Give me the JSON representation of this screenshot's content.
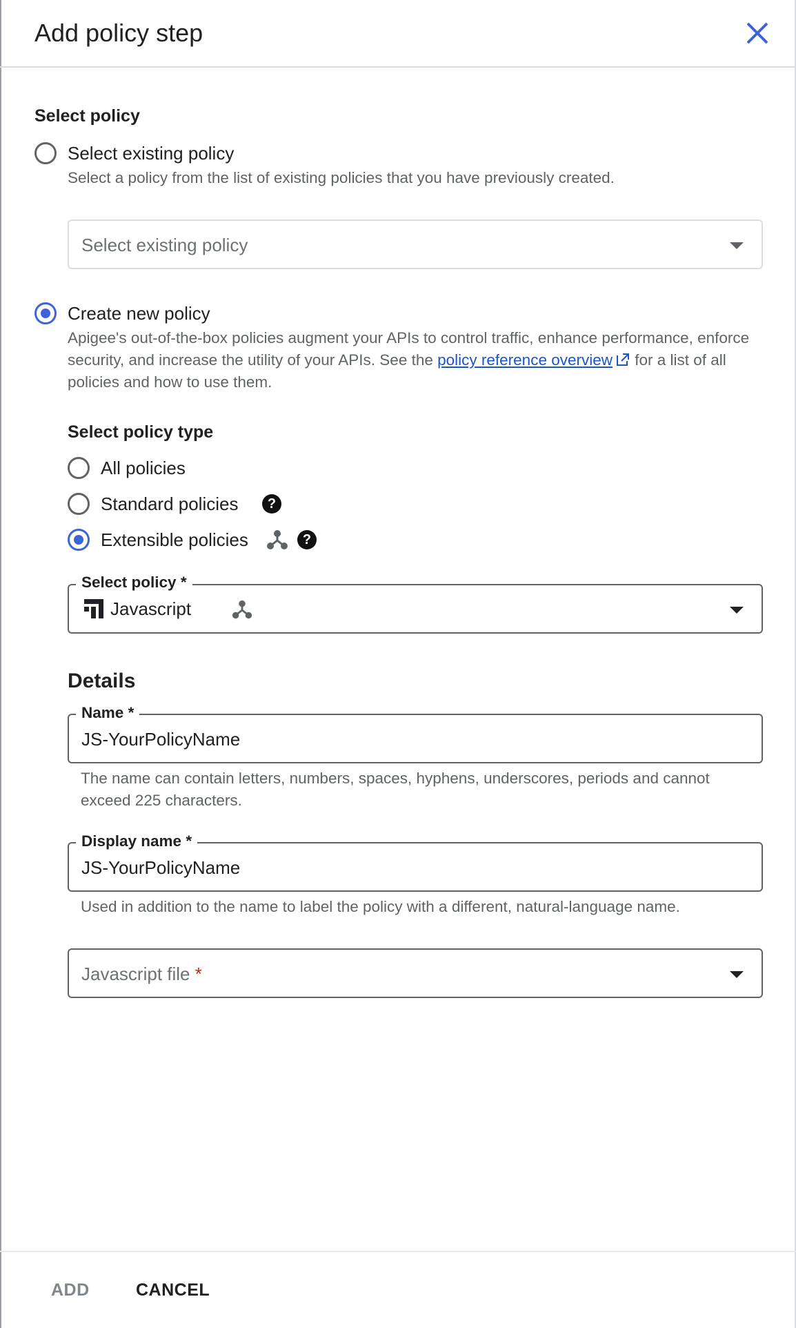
{
  "dialog": {
    "title": "Add policy step",
    "close_icon": "close-icon"
  },
  "select_policy": {
    "heading": "Select policy",
    "existing": {
      "label": "Select existing policy",
      "description": "Select a policy from the list of existing policies that you have previously created.",
      "dropdown_placeholder": "Select existing policy",
      "checked": false
    },
    "create_new": {
      "label": "Create new policy",
      "description_before": "Apigee's out-of-the-box policies augment your APIs to control traffic, enhance performance, enforce security, and increase the utility of your APIs. See the ",
      "link_text": "policy reference overview",
      "description_after": " for a list of all policies and how to use them.",
      "checked": true
    }
  },
  "policy_type": {
    "heading": "Select policy type",
    "options": [
      {
        "label": "All policies",
        "checked": false
      },
      {
        "label": "Standard policies",
        "checked": false,
        "help": "?"
      },
      {
        "label": "Extensible policies",
        "checked": true,
        "help": "?"
      }
    ]
  },
  "select_policy_field": {
    "label": "Select policy",
    "required_mark": "*",
    "value": "Javascript",
    "icon": "javascript-policy-icon"
  },
  "details": {
    "heading": "Details",
    "name": {
      "label": "Name",
      "required_mark": "*",
      "value": "JS-YourPolicyName",
      "hint": "The name can contain letters, numbers, spaces, hyphens, underscores, periods and cannot exceed 225 characters."
    },
    "display_name": {
      "label": "Display name",
      "required_mark": "*",
      "value": "JS-YourPolicyName",
      "hint": "Used in addition to the name to label the policy with a different, natural-language name."
    },
    "js_file": {
      "placeholder": "Javascript file",
      "required_mark": "*"
    }
  },
  "footer": {
    "add_label": "ADD",
    "cancel_label": "CANCEL"
  },
  "colors": {
    "accent": "#3c64d8",
    "link": "#1a56c8",
    "required": "#c5221f"
  }
}
